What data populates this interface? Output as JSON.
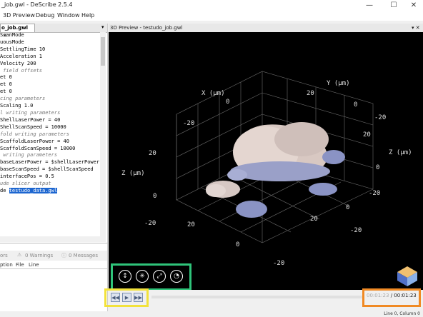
{
  "window": {
    "title": "_job.gwl - DeScribe 2.5.4",
    "minimize": "—",
    "maximize": "☐",
    "close": "✕"
  },
  "menu": [
    "3D Preview",
    "Debug",
    "Window",
    "Help"
  ],
  "editor": {
    "tab_label": "o_job.gwl",
    "tab_close": "✕",
    "tab_pin": "▾",
    "lines": [
      {
        "t": "ScanMode",
        "cls": ""
      },
      {
        "t": "uousMode",
        "cls": ""
      },
      {
        "t": "SettlingTime 10",
        "cls": ""
      },
      {
        "t": "Acceleration 1",
        "cls": ""
      },
      {
        "t": "Velocity 200",
        "cls": ""
      },
      {
        "t": "",
        "cls": ""
      },
      {
        "t": " field offsets",
        "cls": "c"
      },
      {
        "t": "et 0",
        "cls": ""
      },
      {
        "t": "et 0",
        "cls": ""
      },
      {
        "t": "et 0",
        "cls": ""
      },
      {
        "t": "",
        "cls": ""
      },
      {
        "t": "cing parameters",
        "cls": "c"
      },
      {
        "t": "Scaling 1.0",
        "cls": ""
      },
      {
        "t": "",
        "cls": ""
      },
      {
        "t": "l writing parameters",
        "cls": "c"
      },
      {
        "t": "ShellLaserPower = 40",
        "cls": ""
      },
      {
        "t": "ShellScanSpeed = 10000",
        "cls": ""
      },
      {
        "t": "",
        "cls": ""
      },
      {
        "t": "fold writing parameters",
        "cls": "c"
      },
      {
        "t": "ScaffoldLaserPower = 40",
        "cls": ""
      },
      {
        "t": "ScaffoldScanSpeed = 10000",
        "cls": ""
      },
      {
        "t": "",
        "cls": ""
      },
      {
        "t": " writing parameters",
        "cls": "c"
      },
      {
        "t": "baseLaserPower = $shellLaserPower",
        "cls": ""
      },
      {
        "t": "baseScanSpeed = $shellScanSpeed",
        "cls": ""
      },
      {
        "t": "",
        "cls": ""
      },
      {
        "t": "interfacePos = 0.5",
        "cls": ""
      },
      {
        "t": "",
        "cls": ""
      },
      {
        "t": "ude slicer output",
        "cls": "c"
      }
    ],
    "include_prefix": "de ",
    "include_file": "testudo_data.gwl"
  },
  "messages": {
    "errors": "ors",
    "warnings": "0 Warnings",
    "messages": "0 Messages",
    "col_description": "ption",
    "col_file": "File",
    "col_line": "Line"
  },
  "preview": {
    "title": "3D Preview - testudo_job.gwl",
    "header_controls": "▾ ✕",
    "axes": {
      "x_label": "X  (µm)",
      "y_label": "Y  (µm)",
      "z_label_left": "Z  (µm)",
      "z_label_right": "Z  (µm)",
      "ticks": {
        "x_top": [
          "0",
          "-20"
        ],
        "y_top": [
          "20",
          "0"
        ],
        "y_neg": "-20",
        "z_left": [
          "20",
          "0",
          "-20"
        ],
        "z_right": [
          "20",
          "0",
          "-20"
        ],
        "x_bottom": [
          "20",
          "0",
          "-20"
        ],
        "y_bottom": [
          "20",
          "0",
          "-20"
        ]
      }
    },
    "view_tools": [
      "zoom-icon",
      "rotate-icon",
      "pan-icon",
      "reset-view-icon"
    ]
  },
  "playback": {
    "rewind": "◀◀",
    "play": "▶",
    "forward": "▶▶",
    "elapsed": "00:01:23",
    "separator": "/",
    "total": "00:01:23",
    "progress": 0.0
  },
  "status": {
    "position": "Line 0, Column 0"
  }
}
